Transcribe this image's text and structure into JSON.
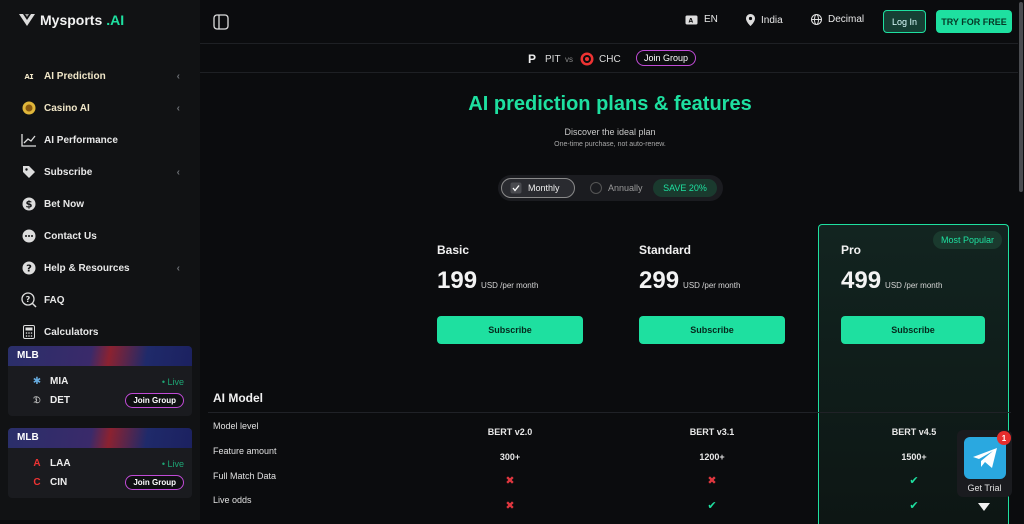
{
  "brand": {
    "name": "Mysports",
    "suffix": ".AI"
  },
  "sidebar": {
    "items": [
      {
        "label": "AI Prediction",
        "icon": "ai-icon",
        "chevron": "‹"
      },
      {
        "label": "Casino AI",
        "icon": "casino-chip-icon",
        "chevron": "‹"
      },
      {
        "label": "AI Performance",
        "icon": "chart-line-icon",
        "chevron": ""
      },
      {
        "label": "Subscribe",
        "icon": "tag-icon",
        "chevron": "‹"
      },
      {
        "label": "Bet Now",
        "icon": "dollar-icon",
        "chevron": ""
      },
      {
        "label": "Contact Us",
        "icon": "chat-icon",
        "chevron": ""
      },
      {
        "label": "Help & Resources",
        "icon": "help-icon",
        "chevron": "‹"
      },
      {
        "label": "FAQ",
        "icon": "faq-icon",
        "chevron": ""
      },
      {
        "label": "Calculators",
        "icon": "calculator-icon",
        "chevron": ""
      }
    ],
    "matches": [
      {
        "league": "MLB",
        "team1": "MIA",
        "team2": "DET",
        "status": "• Live",
        "join": "Join Group"
      },
      {
        "league": "MLB",
        "team1": "LAA",
        "team2": "CIN",
        "status": "• Live",
        "join": "Join Group"
      }
    ]
  },
  "topbar": {
    "language": "EN",
    "region": "India",
    "odds_format": "Decimal",
    "login": "Log In",
    "try_free": "TRY FOR FREE"
  },
  "matchbar": {
    "team1": "PIT",
    "vs": "vs",
    "team2": "CHC",
    "join": "Join Group"
  },
  "pricing": {
    "title": "AI prediction plans & features",
    "subtitle": "Discover the ideal plan",
    "note": "One-time purchase, not auto-renew.",
    "toggle": {
      "monthly": "Monthly",
      "annually": "Annually",
      "save": "SAVE 20%"
    },
    "popular": "Most Popular",
    "plans": [
      {
        "name": "Basic",
        "price": "199",
        "unit": "USD /per month",
        "button": "Subscribe"
      },
      {
        "name": "Standard",
        "price": "299",
        "unit": "USD /per month",
        "button": "Subscribe"
      },
      {
        "name": "Pro",
        "price": "499",
        "unit": "USD /per month",
        "button": "Subscribe"
      }
    ]
  },
  "features": {
    "section": "AI Model",
    "rows": [
      {
        "label": "Model level",
        "values": [
          "BERT v2.0",
          "BERT v3.1",
          "BERT v4.5"
        ]
      },
      {
        "label": "Feature amount",
        "values": [
          "300+",
          "1200+",
          "1500+"
        ]
      },
      {
        "label": "Full Match Data",
        "values": [
          "✖",
          "✖",
          "✔"
        ]
      },
      {
        "label": "Live odds",
        "values": [
          "✖",
          "✔",
          "✔"
        ]
      }
    ]
  },
  "trial": {
    "label": "Get Trial",
    "badge": "1"
  },
  "colors": {
    "accent": "#1ee0a0",
    "background": "#0b0c0e",
    "danger": "#e0373f"
  }
}
